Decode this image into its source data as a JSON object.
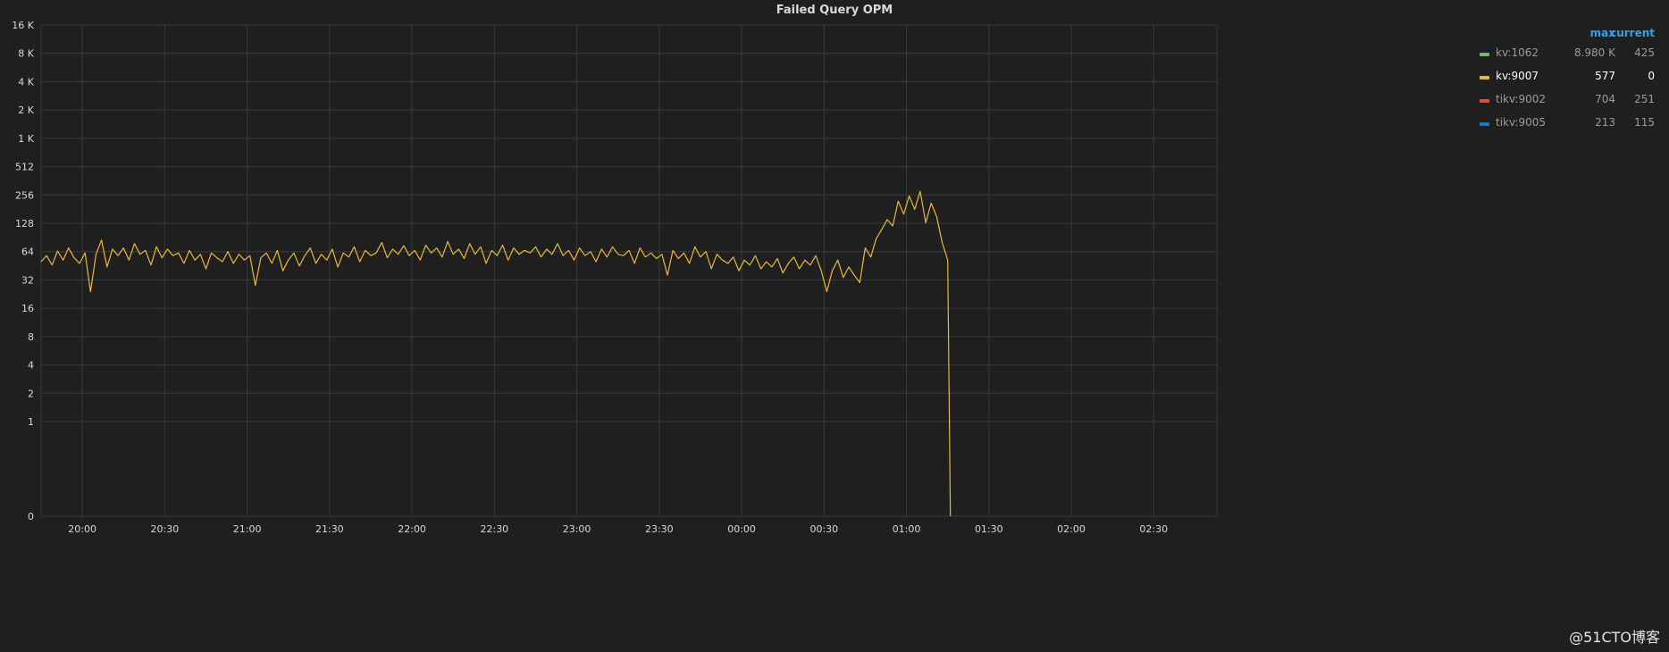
{
  "panel": {
    "title": "Failed Query OPM",
    "watermark": "@51CTO博客"
  },
  "legend": {
    "header_max": "max",
    "header_current": "current",
    "items": [
      {
        "name": "kv:1062",
        "max": "8.980 K",
        "current": "425",
        "color": "#7eb26d",
        "active": false
      },
      {
        "name": "kv:9007",
        "max": "577",
        "current": "0",
        "color": "#eab839",
        "active": true
      },
      {
        "name": "tikv:9002",
        "max": "704",
        "current": "251",
        "color": "#e24d42",
        "active": false
      },
      {
        "name": "tikv:9005",
        "max": "213",
        "current": "115",
        "color": "#1f78c1",
        "active": false
      }
    ]
  },
  "colors": {
    "background": "#1f1f1f",
    "grid": "#3a3a3a",
    "text": "#d8d9da",
    "series": "#eab839",
    "header_accent": "#33a2e5"
  },
  "chart_data": {
    "type": "line",
    "scale": "log2",
    "grid": true,
    "legend_position": "right",
    "y_ticks": [
      {
        "value": 0,
        "label": "0"
      },
      {
        "value": 1,
        "label": "1"
      },
      {
        "value": 2,
        "label": "2"
      },
      {
        "value": 4,
        "label": "4"
      },
      {
        "value": 8,
        "label": "8"
      },
      {
        "value": 16,
        "label": "16"
      },
      {
        "value": 32,
        "label": "32"
      },
      {
        "value": 64,
        "label": "64"
      },
      {
        "value": 128,
        "label": "128"
      },
      {
        "value": 256,
        "label": "256"
      },
      {
        "value": 512,
        "label": "512"
      },
      {
        "value": 1024,
        "label": "1 K"
      },
      {
        "value": 2048,
        "label": "2 K"
      },
      {
        "value": 4096,
        "label": "4 K"
      },
      {
        "value": 8192,
        "label": "8 K"
      },
      {
        "value": 16384,
        "label": "16 K"
      }
    ],
    "ylim": [
      0,
      16384
    ],
    "x_ticks": [
      "20:00",
      "20:30",
      "21:00",
      "21:30",
      "22:00",
      "22:30",
      "23:00",
      "23:30",
      "00:00",
      "00:30",
      "01:00",
      "01:30",
      "02:00",
      "02:30"
    ],
    "xlim": [
      "19:45",
      "02:53"
    ],
    "series": [
      {
        "name": "kv:9007",
        "color": "#eab839",
        "points": [
          [
            "19:45",
            50
          ],
          [
            "19:47",
            58
          ],
          [
            "19:49",
            46
          ],
          [
            "19:51",
            65
          ],
          [
            "19:53",
            52
          ],
          [
            "19:55",
            70
          ],
          [
            "19:57",
            55
          ],
          [
            "19:59",
            48
          ],
          [
            "20:01",
            62
          ],
          [
            "20:03",
            24
          ],
          [
            "20:05",
            60
          ],
          [
            "20:07",
            85
          ],
          [
            "20:09",
            44
          ],
          [
            "20:11",
            68
          ],
          [
            "20:13",
            58
          ],
          [
            "20:15",
            70
          ],
          [
            "20:17",
            52
          ],
          [
            "20:19",
            78
          ],
          [
            "20:21",
            60
          ],
          [
            "20:23",
            66
          ],
          [
            "20:25",
            46
          ],
          [
            "20:27",
            72
          ],
          [
            "20:29",
            55
          ],
          [
            "20:31",
            68
          ],
          [
            "20:33",
            58
          ],
          [
            "20:35",
            62
          ],
          [
            "20:37",
            48
          ],
          [
            "20:39",
            66
          ],
          [
            "20:41",
            52
          ],
          [
            "20:43",
            60
          ],
          [
            "20:45",
            42
          ],
          [
            "20:47",
            62
          ],
          [
            "20:49",
            55
          ],
          [
            "20:51",
            50
          ],
          [
            "20:53",
            64
          ],
          [
            "20:55",
            48
          ],
          [
            "20:57",
            60
          ],
          [
            "20:59",
            52
          ],
          [
            "21:01",
            58
          ],
          [
            "21:03",
            28
          ],
          [
            "21:05",
            55
          ],
          [
            "21:07",
            62
          ],
          [
            "21:09",
            48
          ],
          [
            "21:11",
            66
          ],
          [
            "21:13",
            40
          ],
          [
            "21:15",
            52
          ],
          [
            "21:17",
            62
          ],
          [
            "21:19",
            45
          ],
          [
            "21:21",
            58
          ],
          [
            "21:23",
            70
          ],
          [
            "21:25",
            48
          ],
          [
            "21:27",
            60
          ],
          [
            "21:29",
            52
          ],
          [
            "21:31",
            68
          ],
          [
            "21:33",
            44
          ],
          [
            "21:35",
            62
          ],
          [
            "21:37",
            56
          ],
          [
            "21:39",
            72
          ],
          [
            "21:41",
            50
          ],
          [
            "21:43",
            66
          ],
          [
            "21:45",
            58
          ],
          [
            "21:47",
            62
          ],
          [
            "21:49",
            80
          ],
          [
            "21:51",
            55
          ],
          [
            "21:53",
            68
          ],
          [
            "21:55",
            60
          ],
          [
            "21:57",
            74
          ],
          [
            "21:59",
            58
          ],
          [
            "22:01",
            66
          ],
          [
            "22:03",
            52
          ],
          [
            "22:05",
            75
          ],
          [
            "22:07",
            62
          ],
          [
            "22:09",
            70
          ],
          [
            "22:11",
            56
          ],
          [
            "22:13",
            82
          ],
          [
            "22:15",
            60
          ],
          [
            "22:17",
            68
          ],
          [
            "22:19",
            54
          ],
          [
            "22:21",
            78
          ],
          [
            "22:23",
            60
          ],
          [
            "22:25",
            72
          ],
          [
            "22:27",
            48
          ],
          [
            "22:29",
            66
          ],
          [
            "22:31",
            58
          ],
          [
            "22:33",
            75
          ],
          [
            "22:35",
            52
          ],
          [
            "22:37",
            70
          ],
          [
            "22:39",
            60
          ],
          [
            "22:41",
            66
          ],
          [
            "22:43",
            62
          ],
          [
            "22:45",
            72
          ],
          [
            "22:47",
            56
          ],
          [
            "22:49",
            68
          ],
          [
            "22:51",
            60
          ],
          [
            "22:53",
            78
          ],
          [
            "22:55",
            58
          ],
          [
            "22:57",
            66
          ],
          [
            "22:59",
            52
          ],
          [
            "23:01",
            70
          ],
          [
            "23:03",
            58
          ],
          [
            "23:05",
            64
          ],
          [
            "23:07",
            50
          ],
          [
            "23:09",
            68
          ],
          [
            "23:11",
            56
          ],
          [
            "23:13",
            72
          ],
          [
            "23:15",
            60
          ],
          [
            "23:17",
            58
          ],
          [
            "23:19",
            66
          ],
          [
            "23:21",
            48
          ],
          [
            "23:23",
            70
          ],
          [
            "23:25",
            56
          ],
          [
            "23:27",
            62
          ],
          [
            "23:29",
            54
          ],
          [
            "23:31",
            60
          ],
          [
            "23:33",
            36
          ],
          [
            "23:35",
            66
          ],
          [
            "23:37",
            54
          ],
          [
            "23:39",
            62
          ],
          [
            "23:41",
            48
          ],
          [
            "23:43",
            72
          ],
          [
            "23:45",
            56
          ],
          [
            "23:47",
            64
          ],
          [
            "23:49",
            42
          ],
          [
            "23:51",
            60
          ],
          [
            "23:53",
            52
          ],
          [
            "23:55",
            48
          ],
          [
            "23:57",
            56
          ],
          [
            "23:59",
            40
          ],
          [
            "00:01",
            52
          ],
          [
            "00:03",
            46
          ],
          [
            "00:05",
            58
          ],
          [
            "00:07",
            42
          ],
          [
            "00:09",
            50
          ],
          [
            "00:11",
            44
          ],
          [
            "00:13",
            54
          ],
          [
            "00:15",
            38
          ],
          [
            "00:17",
            48
          ],
          [
            "00:19",
            56
          ],
          [
            "00:21",
            42
          ],
          [
            "00:23",
            52
          ],
          [
            "00:25",
            46
          ],
          [
            "00:27",
            58
          ],
          [
            "00:29",
            40
          ],
          [
            "00:31",
            24
          ],
          [
            "00:33",
            40
          ],
          [
            "00:35",
            52
          ],
          [
            "00:37",
            34
          ],
          [
            "00:39",
            44
          ],
          [
            "00:41",
            36
          ],
          [
            "00:43",
            30
          ],
          [
            "00:45",
            70
          ],
          [
            "00:47",
            56
          ],
          [
            "00:49",
            88
          ],
          [
            "00:51",
            110
          ],
          [
            "00:53",
            140
          ],
          [
            "00:55",
            120
          ],
          [
            "00:57",
            220
          ],
          [
            "00:59",
            160
          ],
          [
            "01:01",
            250
          ],
          [
            "01:03",
            180
          ],
          [
            "01:05",
            280
          ],
          [
            "01:07",
            130
          ],
          [
            "01:09",
            210
          ],
          [
            "01:11",
            150
          ],
          [
            "01:13",
            80
          ],
          [
            "01:15",
            52
          ],
          [
            "01:16",
            0
          ]
        ]
      }
    ]
  }
}
